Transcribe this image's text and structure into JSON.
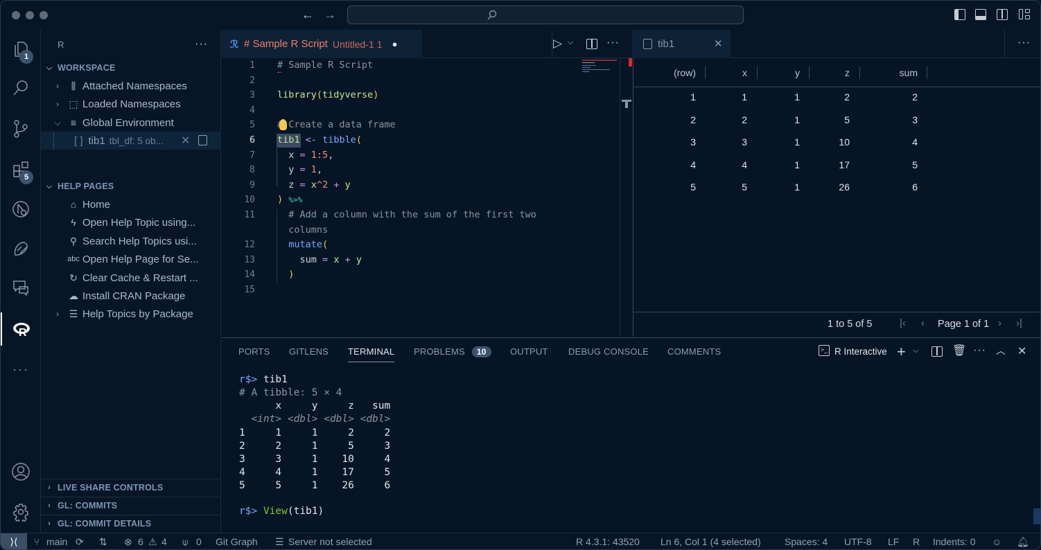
{
  "titlebar": {
    "search_placeholder": ""
  },
  "activity_bar": {
    "explorer_badge": "1",
    "extensions_badge": "5"
  },
  "sidebar": {
    "title": "R",
    "workspace": {
      "header": "WORKSPACE",
      "items": [
        {
          "label": "Attached Namespaces",
          "icon": "library-icon"
        },
        {
          "label": "Loaded Namespaces",
          "icon": "package-icon"
        },
        {
          "label": "Global Environment",
          "icon": "list-icon"
        }
      ],
      "env_item": {
        "name": "tib1",
        "type": "tbl_df: 5 ob...",
        "icon_text": "[ ]"
      }
    },
    "help_pages": {
      "header": "HELP PAGES",
      "items": [
        {
          "label": "Home",
          "icon": "⌂"
        },
        {
          "label": "Open Help Topic using...",
          "icon": "ϟ"
        },
        {
          "label": "Search Help Topics usi...",
          "icon": "⚲"
        },
        {
          "label": "Open Help Page for Se...",
          "icon": "abc"
        },
        {
          "label": "Clear Cache & Restart ...",
          "icon": "↻"
        },
        {
          "label": "Install CRAN Package",
          "icon": "☁"
        },
        {
          "label": "Help Topics by Package",
          "icon": "☰"
        }
      ]
    },
    "collapsed_sections": [
      "LIVE SHARE CONTROLS",
      "GL: COMMITS",
      "GL: COMMIT DETAILS"
    ]
  },
  "editor": {
    "tab": {
      "title": "# Sample R Script",
      "subtitle": "Untitled-1",
      "problems": "1",
      "dirty": "●"
    },
    "line_numbers": [
      "1",
      "2",
      "3",
      "4",
      "5",
      "6",
      "7",
      "8",
      "9",
      "10",
      "11",
      "",
      "12",
      "13",
      "14",
      "15"
    ],
    "current_line": "6"
  },
  "viewer": {
    "tab_title": "tib1",
    "columns": [
      "(row)",
      "x",
      "y",
      "z",
      "sum"
    ],
    "rows": [
      [
        "1",
        "1",
        "1",
        "2",
        "2"
      ],
      [
        "2",
        "2",
        "1",
        "5",
        "3"
      ],
      [
        "3",
        "3",
        "1",
        "10",
        "4"
      ],
      [
        "4",
        "4",
        "1",
        "17",
        "5"
      ],
      [
        "5",
        "5",
        "1",
        "26",
        "6"
      ]
    ],
    "pager": {
      "range": "1 to 5 of 5",
      "page": "Page 1 of 1"
    }
  },
  "panel": {
    "tabs": [
      "PORTS",
      "GITLENS",
      "TERMINAL",
      "PROBLEMS",
      "OUTPUT",
      "DEBUG CONSOLE",
      "COMMENTS"
    ],
    "active_tab": "TERMINAL",
    "problems_count": "10",
    "terminal_name": "R Interactive",
    "terminal_lines": [
      "# A tibble: 5 × 4",
      "      x     y     z   sum",
      "  <int> <dbl> <dbl> <dbl>",
      "1     1     1     2     2",
      "2     2     1     5     3",
      "3     3     1    10     4",
      "4     4     1    17     5",
      "5     5     1    26     6"
    ],
    "prompt": "r$>",
    "cmd1": "tib1",
    "cmd2_fn": "View",
    "cmd2_args": "(tib1)"
  },
  "statusbar": {
    "branch": "main",
    "errors": "6",
    "warnings": "4",
    "ports": "0",
    "git_graph": "Git Graph",
    "server": "Server not selected",
    "r_version": "R 4.3.1: 43520",
    "cursor": "Ln 6, Col 1 (4 selected)",
    "spaces": "Spaces: 4",
    "encoding": "UTF-8",
    "eol": "LF",
    "language": "R",
    "indents": "Indents: 0"
  }
}
